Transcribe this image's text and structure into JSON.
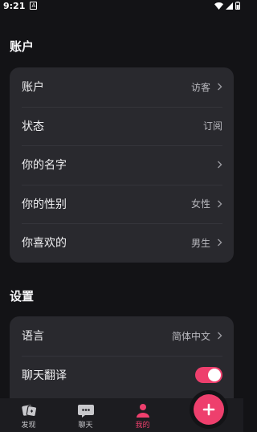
{
  "status_bar": {
    "time": "9:21",
    "notification_glyph": "A"
  },
  "account_section": {
    "title": "账户",
    "rows": [
      {
        "label": "账户",
        "value": "访客"
      },
      {
        "label": "状态",
        "value": "订阅"
      },
      {
        "label": "你的名字",
        "value": ""
      },
      {
        "label": "你的性别",
        "value": "女性"
      },
      {
        "label": "你喜欢的",
        "value": "男生"
      }
    ]
  },
  "settings_section": {
    "title": "设置",
    "rows": [
      {
        "label": "语言",
        "value": "简体中文"
      },
      {
        "label": "聊天翻译",
        "toggle_on": true
      }
    ]
  },
  "bottom_nav": {
    "items": [
      {
        "label": "发现",
        "icon": "discover-icon",
        "active": false
      },
      {
        "label": "聊天",
        "icon": "chat-icon",
        "active": false
      },
      {
        "label": "我的",
        "icon": "profile-icon",
        "active": true
      }
    ],
    "fab_icon": "plus-icon"
  },
  "colors": {
    "accent": "#ee3f6d",
    "card": "#29292e",
    "background": "#131316"
  }
}
